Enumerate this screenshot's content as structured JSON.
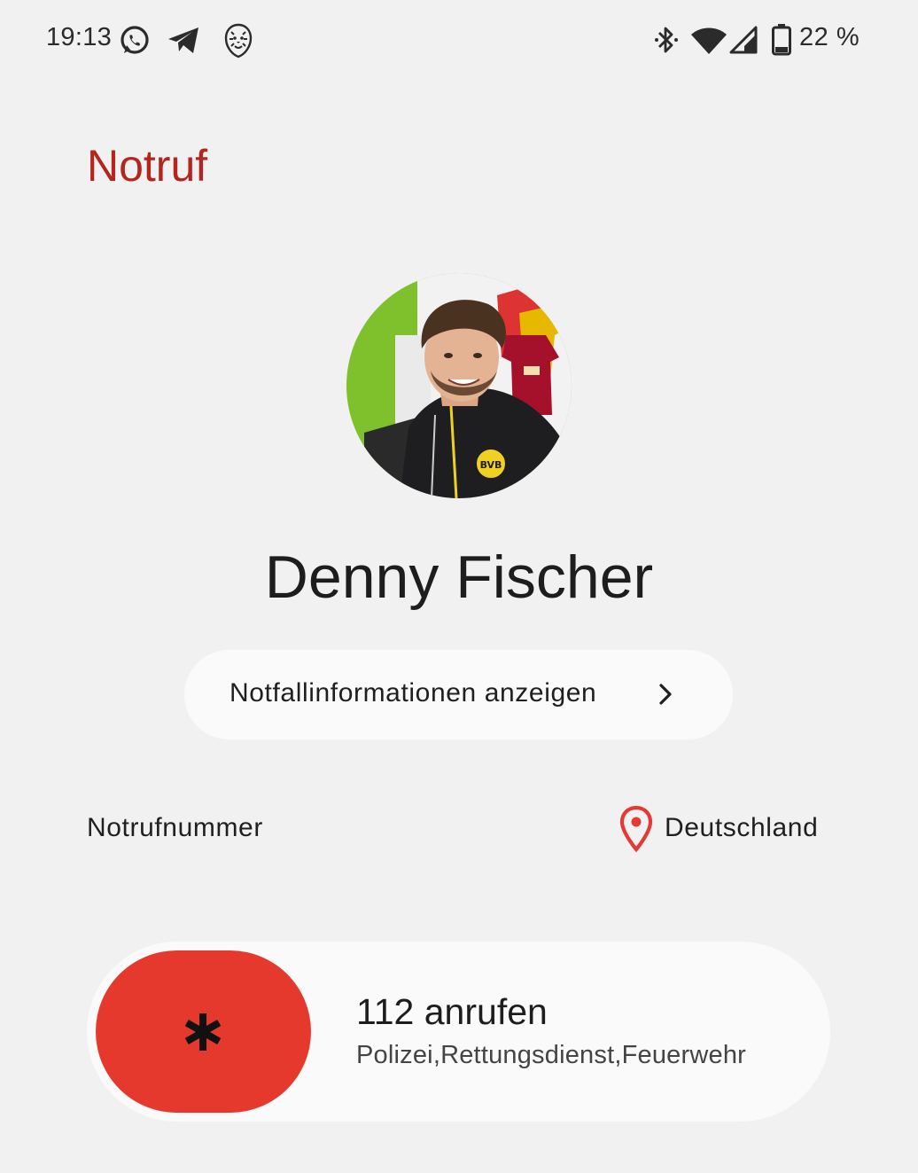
{
  "status_bar": {
    "time": "19:13",
    "notification_icons": [
      "whatsapp-icon",
      "telegram-icon",
      "lion-app-icon"
    ],
    "system_icons": [
      "bluetooth-icon",
      "wifi-icon",
      "signal-icon",
      "battery-icon"
    ],
    "battery": "22 %"
  },
  "page": {
    "title": "Notruf"
  },
  "owner": {
    "name": "Denny Fischer"
  },
  "info_button": {
    "label": "Notfallinformationen anzeigen"
  },
  "emergency": {
    "section_label": "Notrufnummer",
    "location": "Deutschland",
    "call_title": "112 anrufen",
    "call_subtitle": "Polizei,Rettungsdienst,Feuerwehr"
  },
  "colors": {
    "title": "#b3261e",
    "slider": "#e5392e",
    "location_pin": "#e53935",
    "background": "#f1f1f1",
    "pill": "#fafafa"
  }
}
